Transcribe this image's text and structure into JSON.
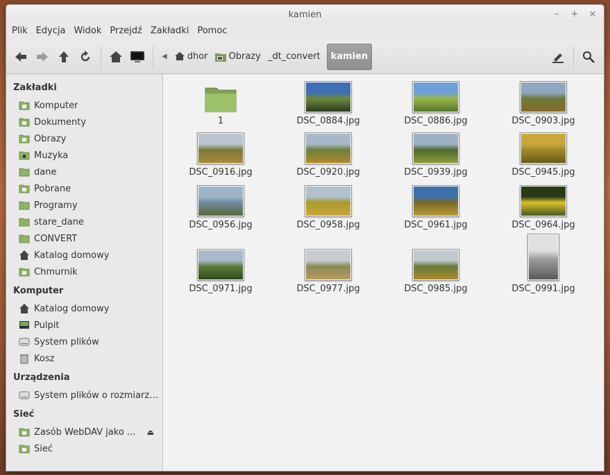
{
  "window": {
    "title": "kamien"
  },
  "menu": [
    "Plik",
    "Edycja",
    "Widok",
    "Przejdź",
    "Zakładki",
    "Pomoc"
  ],
  "toolbar": {
    "icons": [
      "back-icon",
      "forward-icon",
      "up-icon",
      "reload-icon",
      "home-icon",
      "computer-icon"
    ],
    "crumbs": [
      "dhor",
      "Obrazy",
      "_dt_convert",
      "kamien"
    ],
    "right_icons": [
      "edit-path-icon",
      "search-icon"
    ]
  },
  "sidebar": {
    "bookmarks_header": "Zakładki",
    "bookmarks": [
      "Komputer",
      "Dokumenty",
      "Obrazy",
      "Muzyka",
      "dane",
      "Pobrane",
      "Programy",
      "stare_dane",
      "CONVERT",
      "Katalog domowy",
      "Chmurnik"
    ],
    "computer_header": "Komputer",
    "computer": [
      "Katalog domowy",
      "Pulpit",
      "System plików",
      "Kosz"
    ],
    "devices_header": "Urządzenia",
    "devices": [
      "System plików o rozmiarze ..."
    ],
    "network_header": "Sieć",
    "network": [
      "Zasób WebDAV jako ...",
      "Sieć"
    ]
  },
  "files": [
    {
      "name": "1",
      "kind": "folder"
    },
    {
      "name": "DSC_0884.jpg",
      "kind": "image",
      "palette": [
        "#3d6fb2",
        "#6b8a3a",
        "#2d3c1f"
      ]
    },
    {
      "name": "DSC_0886.jpg",
      "kind": "image",
      "palette": [
        "#6fa0d8",
        "#9cb548",
        "#4f7a2a"
      ]
    },
    {
      "name": "DSC_0903.jpg",
      "kind": "image",
      "palette": [
        "#8ea6c0",
        "#6a7a3a",
        "#8a6a2a"
      ]
    },
    {
      "name": "DSC_0916.jpg",
      "kind": "image",
      "palette": [
        "#b9c4cf",
        "#7d7a3c",
        "#a88a3a"
      ]
    },
    {
      "name": "DSC_0920.jpg",
      "kind": "image",
      "palette": [
        "#a8b8c8",
        "#6d7f3b",
        "#b08a2c"
      ]
    },
    {
      "name": "DSC_0939.jpg",
      "kind": "image",
      "palette": [
        "#9fb2c4",
        "#4f6a2c",
        "#8c9a3a"
      ]
    },
    {
      "name": "DSC_0945.jpg",
      "kind": "image",
      "palette": [
        "#c8a83a",
        "#a08a2a",
        "#6a5a1c"
      ]
    },
    {
      "name": "DSC_0956.jpg",
      "kind": "image",
      "palette": [
        "#9fb6c8",
        "#6f8aa0",
        "#5a6a3a"
      ]
    },
    {
      "name": "DSC_0958.jpg",
      "kind": "image",
      "palette": [
        "#b0c0cc",
        "#a89a2c",
        "#c8a838"
      ]
    },
    {
      "name": "DSC_0961.jpg",
      "kind": "image",
      "palette": [
        "#3f6fa8",
        "#7a6a2a",
        "#b89a3a"
      ]
    },
    {
      "name": "DSC_0964.jpg",
      "kind": "image",
      "palette": [
        "#2a3a18",
        "#d8c030",
        "#4a5a22"
      ]
    },
    {
      "name": "DSC_0971.jpg",
      "kind": "image",
      "palette": [
        "#a8b8c8",
        "#5d7a3a",
        "#2d4a1c"
      ]
    },
    {
      "name": "DSC_0977.jpg",
      "kind": "image",
      "palette": [
        "#c8ccd0",
        "#8a8a5a",
        "#b89a5a"
      ]
    },
    {
      "name": "DSC_0985.jpg",
      "kind": "image",
      "palette": [
        "#c0c8ce",
        "#6a7a3a",
        "#a88a2c"
      ]
    },
    {
      "name": "DSC_0991.jpg",
      "kind": "image",
      "palette": [
        "#e0e0e0",
        "#9a9a9a",
        "#5a5a5a"
      ],
      "portrait": true
    }
  ]
}
